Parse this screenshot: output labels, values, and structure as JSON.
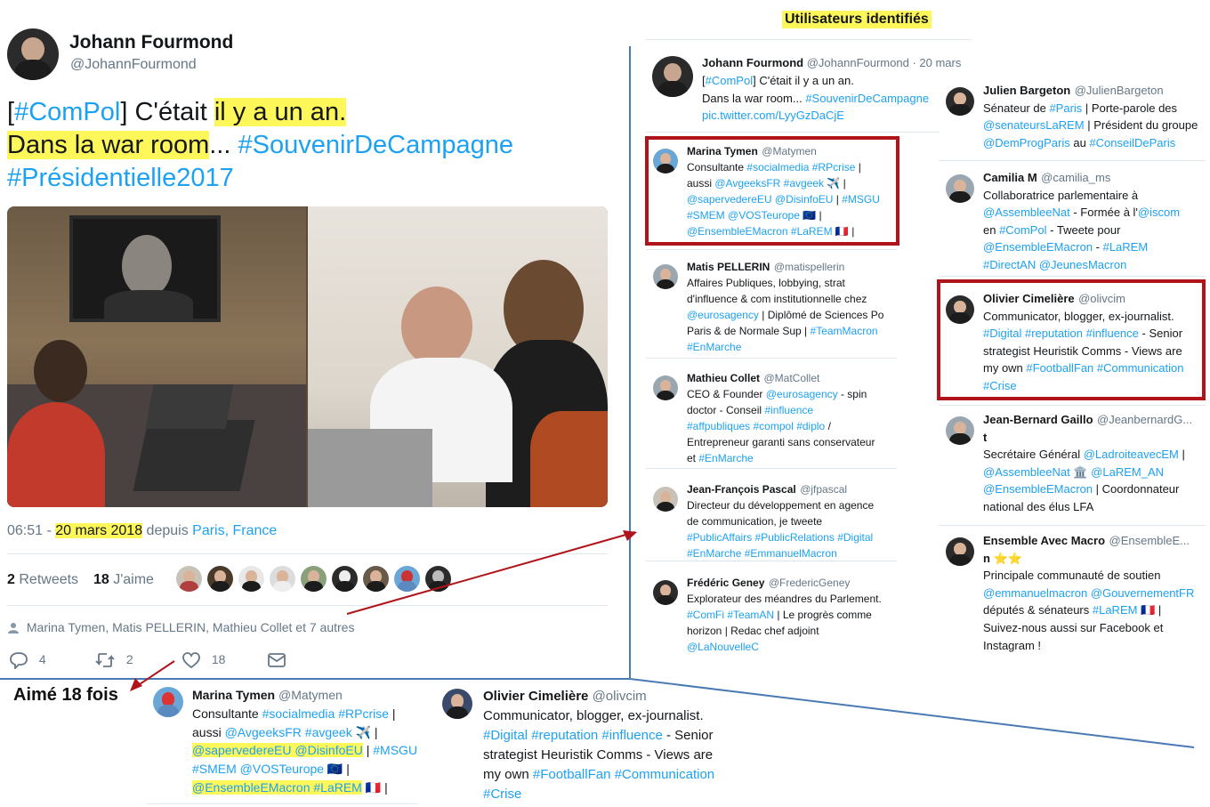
{
  "tweet": {
    "author_name": "Johann Fourmond",
    "author_handle": "@JohannFourmond",
    "text_parts": {
      "bracket_open": "[",
      "hashtag_compol": "#ComPol",
      "bracket_close": "] C'était ",
      "hl_1": "il y a un an.",
      "hl_2": "Dans la war room",
      "ellipsis": "... ",
      "hashtag_souvenir": "#SouvenirDeCampagne",
      "hashtag_presidentielle": "#Présidentielle2017"
    },
    "time": "06:51 - ",
    "date": "20 mars 2018",
    "from_label": " depuis ",
    "location": "Paris, France",
    "retweets_count": "2",
    "retweets_label": "Retweets",
    "likes_count": "18",
    "likes_label": "J'aime",
    "liked_by": "Marina Tymen, Matis PELLERIN, Mathieu Collet et 7 autres",
    "actions": {
      "reply": "4",
      "retweet": "2",
      "like": "18"
    }
  },
  "liked_section": {
    "title": "Aimé 18 fois",
    "marina": {
      "name": "Marina Tymen",
      "handle": "@Matymen",
      "l1a": "Consultante ",
      "l1b": "#socialmedia #RPcrise",
      "l1c": " |",
      "l2a": "aussi ",
      "l2b": "@AvgeeksFR #avgeek",
      "l2c": " ✈️ |",
      "l3a": "@sapervedereEU @DisinfoEU",
      "l3b": " | ",
      "l3c": "#MSGU",
      "l4a": "#SMEM @VOSTeurope",
      "l4b": " 🇪🇺 |",
      "l5a": "@EnsembleEMacron #LaREM",
      "l5b": " 🇫🇷 |"
    },
    "olivier": {
      "name": "Olivier Cimelière",
      "handle": "@olivcim",
      "l1": "Communicator, blogger, ex-journalist.",
      "l2a": "#Digital #reputation #influence",
      "l2b": " - Senior",
      "l3": "strategist Heuristik Comms - Views are",
      "l4a": "my own ",
      "l4b": "#FootballFan #Communication",
      "l5": "#Crise"
    }
  },
  "identified": {
    "title": "Utilisateurs identifiés",
    "header_tweet": {
      "name": "Johann Fourmond",
      "handle": "@JohannFourmond · 20 mars",
      "l1a": "[",
      "l1b": "#ComPol",
      "l1c": "] C'était il y a un an.",
      "l2a": "Dans la war room... ",
      "l2b": "#SouvenirDeCampagne",
      "l3": "pic.twitter.com/LyyGzDaCjE"
    },
    "left": [
      {
        "name": "Marina Tymen",
        "handle": "@Matymen",
        "lines": [
          [
            [
              "Consultante ",
              0
            ],
            [
              "#socialmedia #RPcrise",
              1
            ],
            [
              " |",
              0
            ]
          ],
          [
            [
              "aussi ",
              0
            ],
            [
              "@AvgeeksFR #avgeek",
              1
            ],
            [
              " ✈️ |",
              0
            ]
          ],
          [
            [
              "@sapervedereEU @DisinfoEU",
              1
            ],
            [
              " | ",
              0
            ],
            [
              "#MSGU",
              1
            ]
          ],
          [
            [
              "#SMEM @VOSTeurope",
              1
            ],
            [
              " 🇪🇺 |",
              0
            ]
          ],
          [
            [
              "@EnsembleEMacron #LaREM",
              1
            ],
            [
              " 🇫🇷 |",
              0
            ]
          ]
        ]
      },
      {
        "name": "Matis PELLERIN",
        "handle": "@matispellerin",
        "lines": [
          [
            [
              "Affaires Publiques, lobbying, strat",
              0
            ]
          ],
          [
            [
              "d'influence & com institutionnelle chez",
              0
            ]
          ],
          [
            [
              "@eurosagency",
              1
            ],
            [
              " | Diplômé de Sciences Po",
              0
            ]
          ],
          [
            [
              "Paris & de Normale Sup | ",
              0
            ],
            [
              "#TeamMacron",
              1
            ]
          ],
          [
            [
              "#EnMarche",
              1
            ]
          ]
        ]
      },
      {
        "name": "Mathieu Collet",
        "handle": "@MatCollet",
        "lines": [
          [
            [
              "CEO & Founder ",
              0
            ],
            [
              "@eurosagency",
              1
            ],
            [
              " - spin",
              0
            ]
          ],
          [
            [
              "doctor - Conseil ",
              0
            ],
            [
              "#influence",
              1
            ]
          ],
          [
            [
              "#affpubliques #compol #diplo",
              1
            ],
            [
              " /",
              0
            ]
          ],
          [
            [
              "Entrepreneur garanti sans conservateur",
              0
            ]
          ],
          [
            [
              "et ",
              0
            ],
            [
              "#EnMarche",
              1
            ]
          ]
        ]
      },
      {
        "name": "Jean-François Pascal",
        "handle": "@jfpascal",
        "lines": [
          [
            [
              "Directeur du développement en agence",
              0
            ]
          ],
          [
            [
              "de communication, je tweete",
              0
            ]
          ],
          [
            [
              "#PublicAffairs #PublicRelations #Digital",
              1
            ]
          ],
          [
            [
              "#EnMarche #EmmanuelMacron",
              1
            ]
          ]
        ]
      },
      {
        "name": "Frédéric Geney",
        "handle": "@FredericGeney",
        "lines": [
          [
            [
              "Explorateur des méandres du Parlement.",
              0
            ]
          ],
          [
            [
              "#ComFi #TeamAN",
              1
            ],
            [
              " | Le progrès comme",
              0
            ]
          ],
          [
            [
              "horizon | Redac chef adjoint",
              0
            ]
          ],
          [
            [
              "@LaNouvelleC",
              1
            ]
          ]
        ]
      }
    ],
    "right": [
      {
        "name": "Julien Bargeton",
        "handle": "@JulienBargeton",
        "lines": [
          [
            [
              "Sénateur de ",
              0
            ],
            [
              "#Paris",
              1
            ],
            [
              " | Porte-parole des",
              0
            ]
          ],
          [
            [
              "@senateursLaREM",
              1
            ],
            [
              " | Président du groupe",
              0
            ]
          ],
          [
            [
              "@DemProgParis",
              1
            ],
            [
              " au ",
              0
            ],
            [
              "#ConseilDeParis",
              1
            ]
          ]
        ]
      },
      {
        "name": "Camilia M",
        "handle": "@camilia_ms",
        "lines": [
          [
            [
              "Collaboratrice parlementaire à",
              0
            ]
          ],
          [
            [
              "@AssembleeNat",
              1
            ],
            [
              " - Formée à l'",
              0
            ],
            [
              "@iscom",
              1
            ]
          ],
          [
            [
              "en ",
              0
            ],
            [
              "#ComPol",
              1
            ],
            [
              " - Tweete pour",
              0
            ]
          ],
          [
            [
              "@EnsembleEMacron",
              1
            ],
            [
              " - ",
              0
            ],
            [
              "#LaREM",
              1
            ]
          ],
          [
            [
              "#DirectAN @JeunesMacron",
              1
            ]
          ]
        ]
      },
      {
        "name": "Olivier Cimelière",
        "handle": "@olivcim",
        "lines": [
          [
            [
              "Communicator, blogger, ex-journalist.",
              0
            ]
          ],
          [
            [
              "#Digital #reputation #influence",
              1
            ],
            [
              " - Senior",
              0
            ]
          ],
          [
            [
              "strategist Heuristik Comms - Views are",
              0
            ]
          ],
          [
            [
              "my own ",
              0
            ],
            [
              "#FootballFan #Communication",
              1
            ]
          ],
          [
            [
              "#Crise",
              1
            ]
          ]
        ]
      },
      {
        "name": "Jean-Bernard Gaillo",
        "handle": "@JeanbernardG...",
        "name2": "t",
        "lines": [
          [
            [
              "Secrétaire Général ",
              0
            ],
            [
              "@LadroiteavecEM",
              1
            ],
            [
              " |",
              0
            ]
          ],
          [
            [
              "@AssembleeNat",
              1
            ],
            [
              " 🏛️ ",
              0
            ],
            [
              "@LaREM_AN",
              1
            ]
          ],
          [
            [
              "@EnsembleEMacron",
              1
            ],
            [
              " | Coordonnateur",
              0
            ]
          ],
          [
            [
              "national des élus LFA",
              0
            ]
          ]
        ]
      },
      {
        "name": "Ensemble Avec Macro",
        "handle": "@EnsembleE...",
        "name2": "n ⭐⭐",
        "lines": [
          [
            [
              "Principale communauté de soutien",
              0
            ]
          ],
          [
            [
              "@emmanuelmacron @GouvernementFR",
              1
            ]
          ],
          [
            [
              "députés & sénateurs ",
              0
            ],
            [
              "#LaREM",
              1
            ],
            [
              " 🇫🇷 |",
              0
            ]
          ],
          [
            [
              "Suivez-nous aussi sur Facebook et",
              0
            ]
          ],
          [
            [
              "Instagram !",
              0
            ]
          ]
        ]
      }
    ]
  },
  "colors": {
    "link": "#1da1f2",
    "highlight": "#fdf75a",
    "annotation_red": "#b0141a",
    "divider_blue": "#4a7ab5",
    "muted": "#657786"
  }
}
